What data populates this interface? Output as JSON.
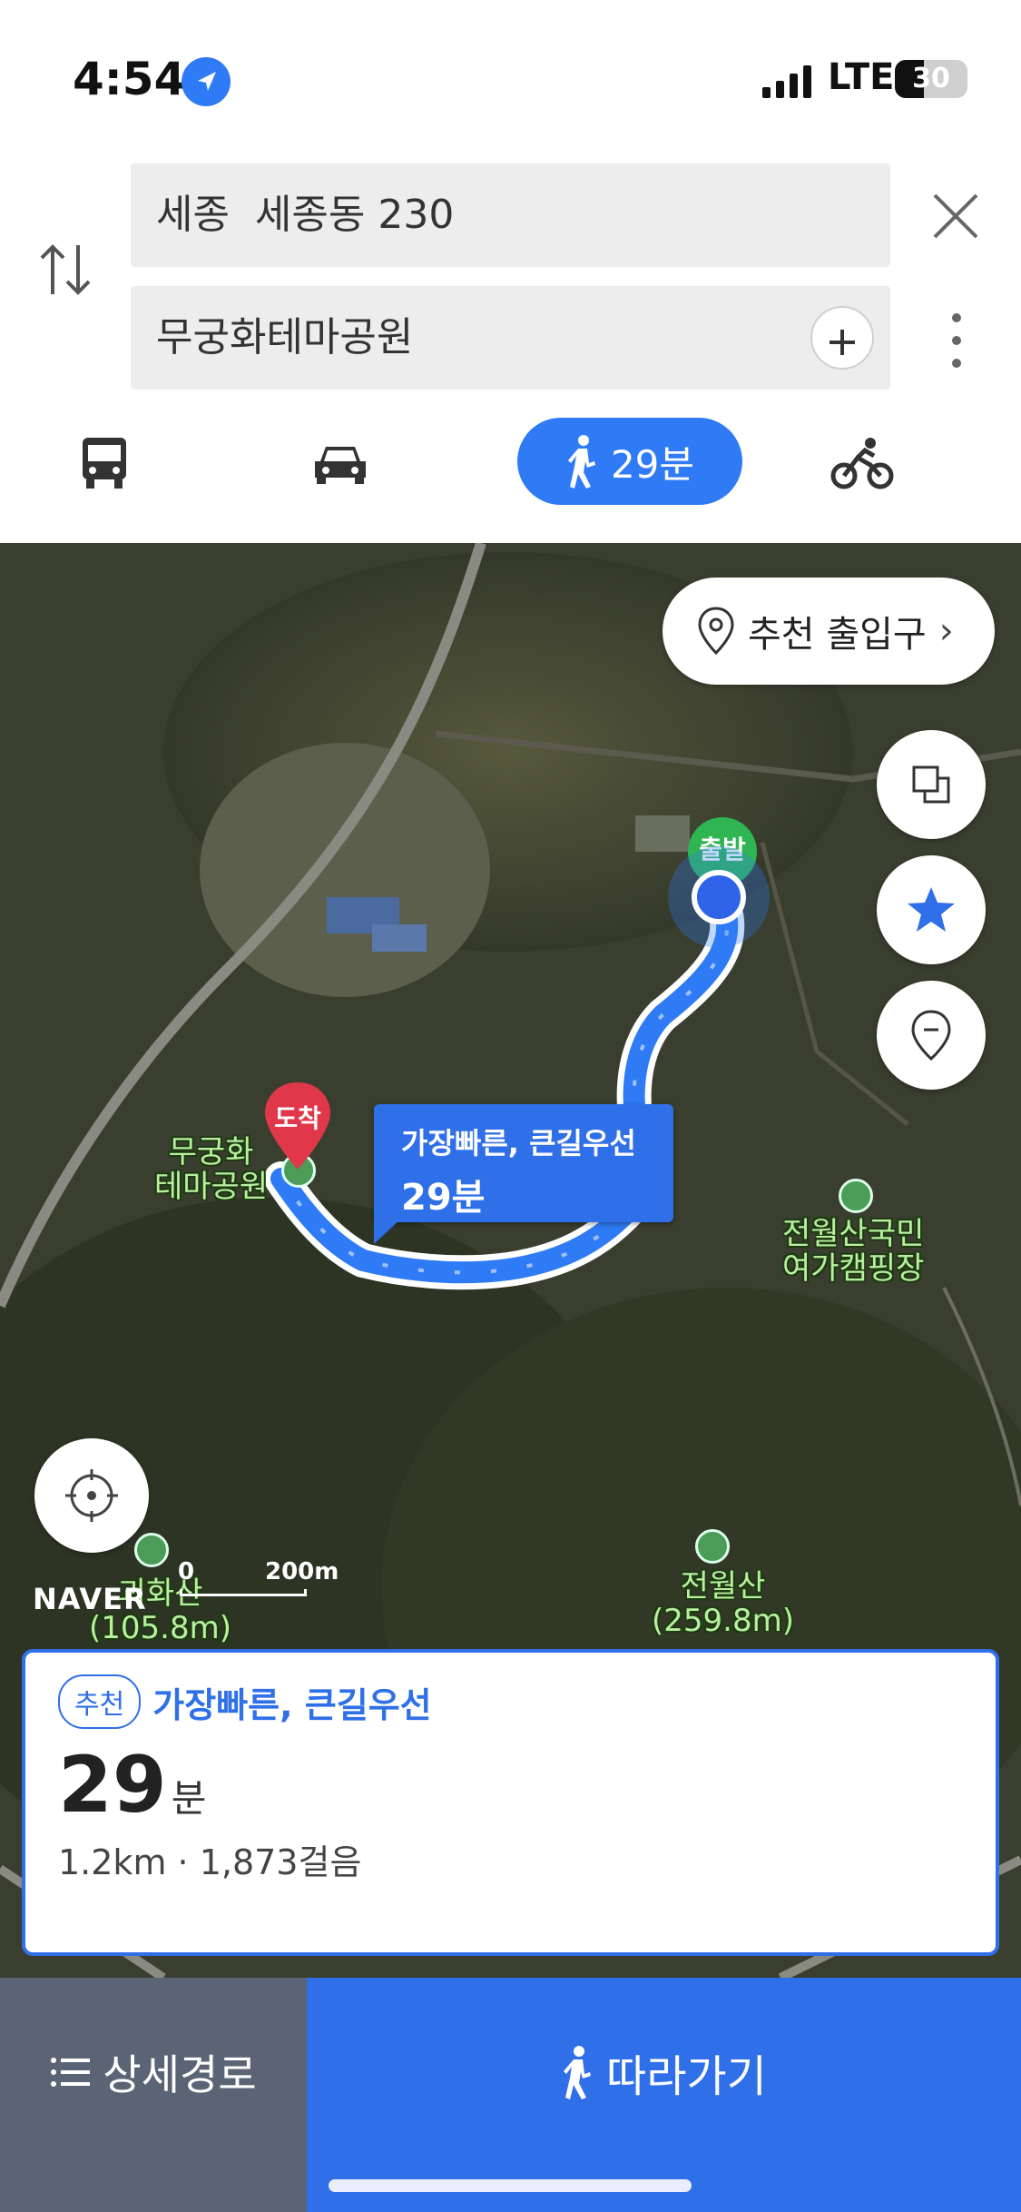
{
  "status": {
    "time": "4:54",
    "network": "LTE",
    "battery": "30"
  },
  "search": {
    "origin": "세종  세종동 230",
    "destination": "무궁화테마공원"
  },
  "modes": {
    "walk_time": "29분"
  },
  "map": {
    "entrance_label": "추천 출입구",
    "start_label": "출발",
    "end_label": "도착",
    "route_label": "가장빠른, 큰길우선",
    "route_time": "29분",
    "place_theme": "무궁화\n테마공원",
    "place_camp": "전월산국민\n여가캠핑장",
    "place_mountain": "전월산\n(259.8m)",
    "place_hill": "괴화산\n(105.8m)",
    "logo": "NAVER",
    "scale_zero": "0",
    "scale_dist": "200m"
  },
  "card": {
    "badge": "추천",
    "title": "가장빠른, 큰길우선",
    "minutes": "29",
    "unit": "분",
    "detail": "1.2km · 1,873걸음"
  },
  "bottom": {
    "detail_label": "상세경로",
    "follow_label": "따라가기"
  },
  "colors": {
    "accent": "#2f6fe8",
    "start": "#2fb653",
    "end": "#e0384a"
  }
}
